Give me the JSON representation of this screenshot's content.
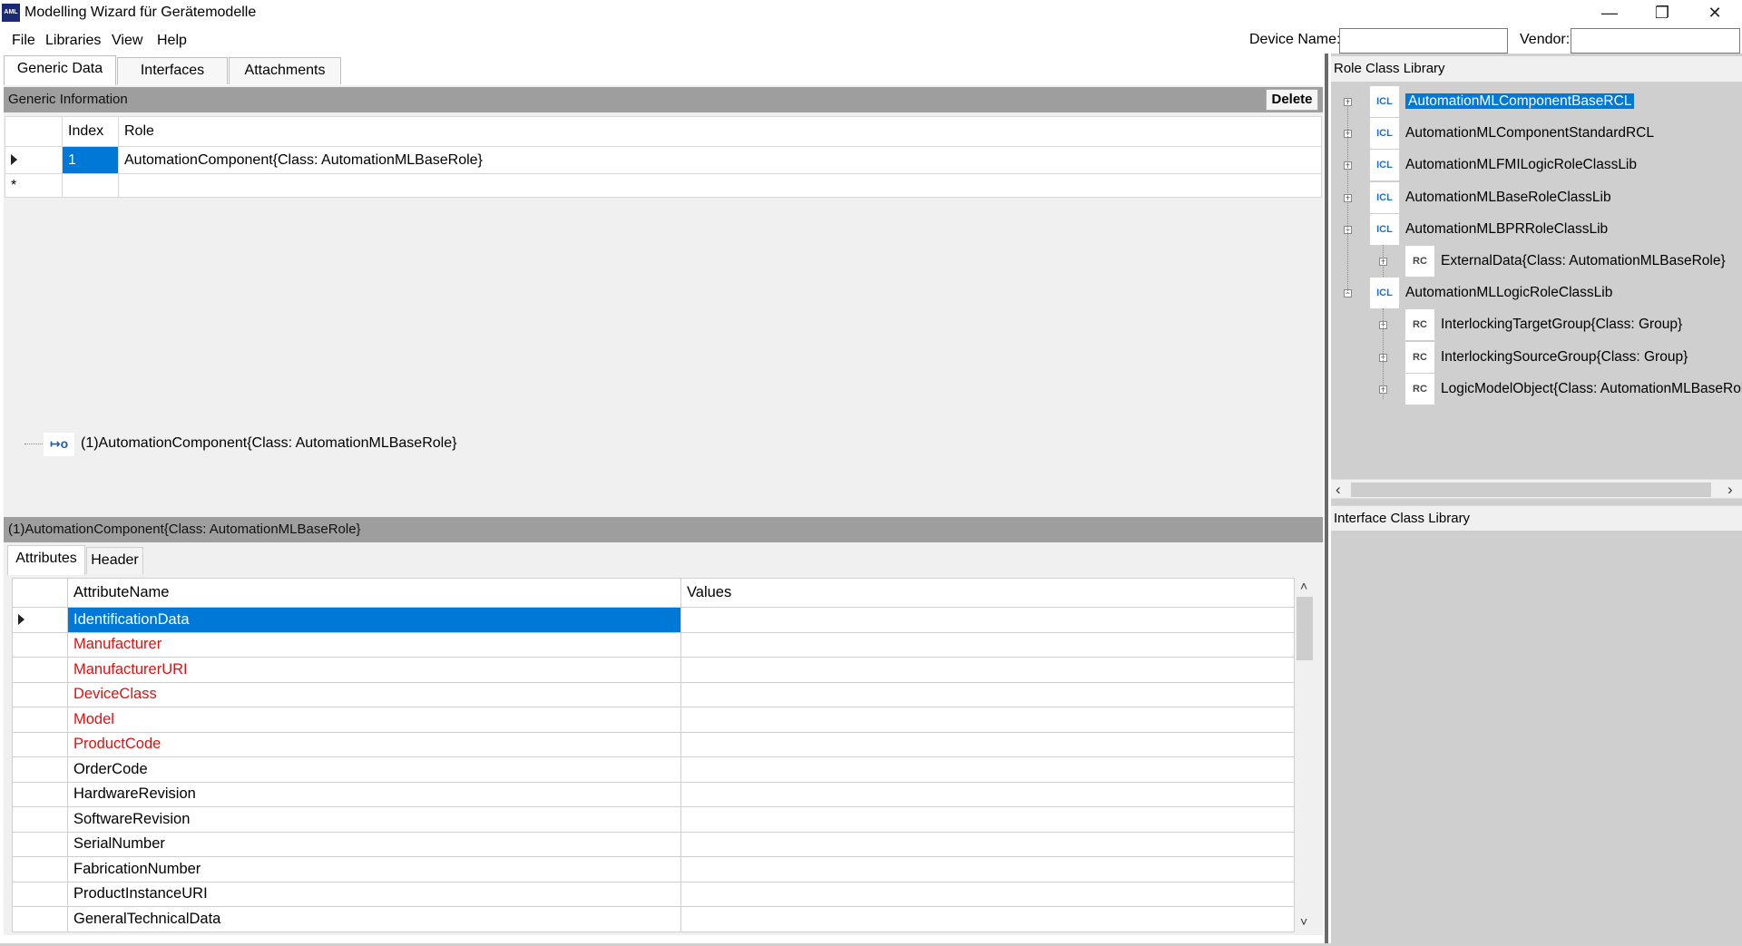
{
  "window": {
    "title": "Modelling Wizard für Gerätemodelle",
    "app_icon_text": "AML",
    "minimize": "—",
    "maximize": "❐",
    "close": "✕"
  },
  "menu": [
    "File",
    "Libraries",
    "View",
    "Help"
  ],
  "device_name_label": "Device Name:",
  "device_name_value": "",
  "vendor_label": "Vendor:",
  "vendor_value": "",
  "tabs": [
    "Generic Data",
    "Interfaces",
    "Attachments"
  ],
  "generic_info": {
    "header": "Generic Information",
    "delete_label": "Delete",
    "columns": [
      "Index",
      "Role"
    ],
    "rows": [
      {
        "index": "1",
        "role": "AutomationComponent{Class:  AutomationMLBaseRole}"
      }
    ],
    "new_row_marker": "*"
  },
  "role_tree_item": "(1)AutomationComponent{Class:  AutomationMLBaseRole}",
  "role_tree_icon": "↦o",
  "attributes_section": {
    "header": "(1)AutomationComponent{Class:  AutomationMLBaseRole}",
    "subtabs": [
      "Attributes",
      "Header"
    ],
    "columns": [
      "AttributeName",
      "Values"
    ],
    "rows": [
      {
        "name": "IdentificationData",
        "value": "",
        "style": "selected"
      },
      {
        "name": "Manufacturer",
        "value": "",
        "style": "red"
      },
      {
        "name": "ManufacturerURI",
        "value": "",
        "style": "red"
      },
      {
        "name": "DeviceClass",
        "value": "",
        "style": "red"
      },
      {
        "name": "Model",
        "value": "",
        "style": "red"
      },
      {
        "name": "ProductCode",
        "value": "",
        "style": "red"
      },
      {
        "name": "OrderCode",
        "value": "",
        "style": "normal"
      },
      {
        "name": "HardwareRevision",
        "value": "",
        "style": "normal"
      },
      {
        "name": "SoftwareRevision",
        "value": "",
        "style": "normal"
      },
      {
        "name": "SerialNumber",
        "value": "",
        "style": "normal"
      },
      {
        "name": "FabricationNumber",
        "value": "",
        "style": "normal"
      },
      {
        "name": "ProductInstanceURI",
        "value": "",
        "style": "normal"
      },
      {
        "name": "GeneralTechnicalData",
        "value": "",
        "style": "normal"
      }
    ]
  },
  "role_class_library": {
    "header": "Role Class Library",
    "items": [
      {
        "label": "AutomationMLComponentBaseRCL",
        "type": "ICL",
        "level": 0,
        "expander": "+",
        "selected": true
      },
      {
        "label": "AutomationMLComponentStandardRCL",
        "type": "ICL",
        "level": 0,
        "expander": "+"
      },
      {
        "label": "AutomationMLFMILogicRoleClassLib",
        "type": "ICL",
        "level": 0,
        "expander": "+"
      },
      {
        "label": "AutomationMLBaseRoleClassLib",
        "type": "ICL",
        "level": 0,
        "expander": "+"
      },
      {
        "label": "AutomationMLBPRRoleClassLib",
        "type": "ICL",
        "level": 0,
        "expander": "−"
      },
      {
        "label": "ExternalData{Class:  AutomationMLBaseRole}",
        "type": "RC",
        "level": 1,
        "expander": "+"
      },
      {
        "label": "AutomationMLLogicRoleClassLib",
        "type": "ICL",
        "level": 0,
        "expander": "−"
      },
      {
        "label": "InterlockingTargetGroup{Class:  Group}",
        "type": "RC",
        "level": 1,
        "expander": "+"
      },
      {
        "label": "InterlockingSourceGroup{Class:  Group}",
        "type": "RC",
        "level": 1,
        "expander": "+"
      },
      {
        "label": "LogicModelObject{Class:  AutomationMLBaseRole}",
        "type": "RC",
        "level": 1,
        "expander": "+"
      }
    ]
  },
  "interface_class_library": {
    "header": "Interface Class Library"
  },
  "icons": {
    "library": "ICL",
    "role_class": "RC",
    "scroll_left": "‹",
    "scroll_right": "›",
    "scroll_up": "˄",
    "scroll_down": "˅"
  }
}
